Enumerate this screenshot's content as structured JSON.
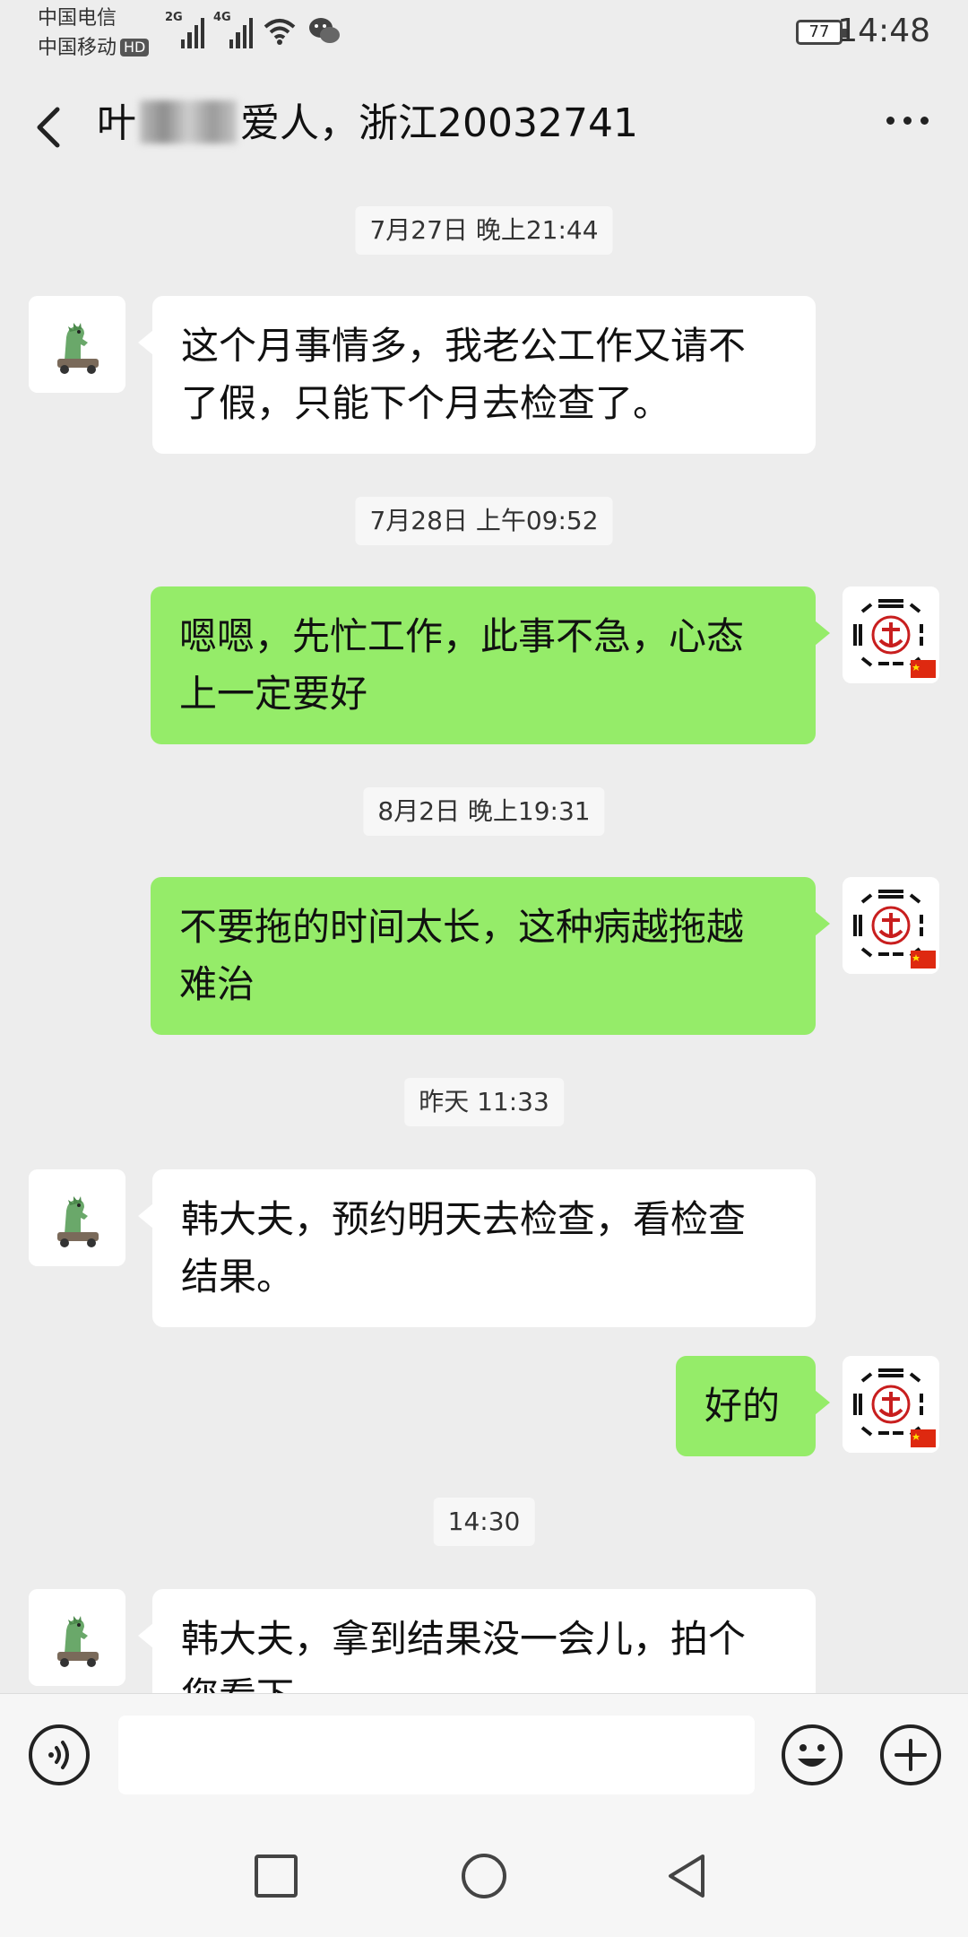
{
  "status_bar": {
    "carrier_1": "中国电信",
    "carrier_2": "中国移动",
    "hd_badge": "HD",
    "net_1": "2G",
    "net_2": "4G",
    "battery": "77",
    "time": "14:48"
  },
  "header": {
    "title_prefix": "叶",
    "title_suffix": "爱人，浙江20032741"
  },
  "messages": [
    {
      "type": "time",
      "text": "7月27日 晚上21:44"
    },
    {
      "type": "incoming",
      "lines": [
        "这个月事情多，我老公工作又请不",
        "了假，只能下个月去检查了。"
      ]
    },
    {
      "type": "time",
      "text": "7月28日 上午09:52"
    },
    {
      "type": "outgoing",
      "lines": [
        "嗯嗯，先忙工作，此事不急，心态",
        "上一定要好"
      ]
    },
    {
      "type": "time",
      "text": "8月2日 晚上19:31"
    },
    {
      "type": "outgoing",
      "lines": [
        "不要拖的时间太长，这种病越拖越",
        "难治"
      ]
    },
    {
      "type": "time",
      "text": "昨天 11:33"
    },
    {
      "type": "incoming",
      "lines": [
        "韩大夫，预约明天去检查，看检查",
        "结果。"
      ]
    },
    {
      "type": "outgoing",
      "lines": [
        "好的"
      ]
    },
    {
      "type": "time",
      "text": "14:30"
    },
    {
      "type": "incoming",
      "lines": [
        "韩大夫，拿到结果没一会儿，拍个",
        "您看下"
      ]
    }
  ],
  "input_bar": {
    "placeholder": "",
    "icons": [
      "voice-icon",
      "emoji-icon",
      "plus-icon"
    ]
  },
  "nav_bar": {
    "icons": [
      "recent-apps-icon",
      "home-icon",
      "back-triangle-icon"
    ]
  },
  "colors": {
    "background": "#ededed",
    "outgoing_bubble": "#95ec69",
    "incoming_bubble": "#ffffff"
  }
}
